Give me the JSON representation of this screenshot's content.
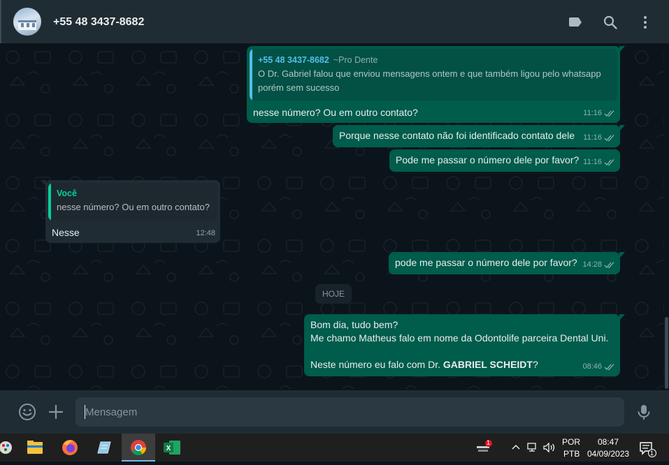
{
  "header": {
    "contact_name": "+55 48 3437-8682",
    "icons": [
      "label-icon",
      "search-icon",
      "menu-icon"
    ]
  },
  "messages": [
    {
      "direction": "out",
      "quote": {
        "author": "+55 48 3437-8682",
        "author_tag": "~Pro Dente",
        "text_line1": "O Dr. Gabriel falou que enviou mensagens ontem e que também ligou pelo whatsapp",
        "text_line2": "porém sem sucesso"
      },
      "text": "nesse número? Ou em outro contato?",
      "time": "11:16"
    },
    {
      "direction": "out",
      "text": "Porque nesse contato não foi identificado contato dele",
      "time": "11:16"
    },
    {
      "direction": "out",
      "text": "Pode me passar o número dele por favor?",
      "time": "11:16"
    },
    {
      "direction": "in",
      "quote": {
        "author": "Você",
        "text": "nesse número? Ou em outro contato?"
      },
      "text": "Nesse",
      "time": "12:48"
    },
    {
      "direction": "out",
      "text": "pode me passar o número dele por favor?",
      "time": "14:28"
    },
    {
      "direction": "out",
      "line1": "Bom dia, tudo bem?",
      "line2": "Me chamo Matheus falo em nome da Odontolife parceira Dental Uni.",
      "line3_prefix": "Neste número eu falo com Dr. ",
      "line3_bold": "GABRIEL SCHEIDT",
      "line3_suffix": "?",
      "time": "08:46"
    }
  ],
  "date_separator": "HOJE",
  "composer": {
    "placeholder": "Mensagem",
    "value": ""
  },
  "taskbar": {
    "apps": [
      "paint-app-icon",
      "file-explorer-icon",
      "firefox-icon",
      "notepad-icon",
      "chrome-icon",
      "excel-icon"
    ],
    "active_app": "chrome-icon",
    "notification_badge": "1",
    "language_line1": "POR",
    "language_line2": "PTB",
    "time": "08:47",
    "date": "04/09/2023",
    "action_center_count": "1"
  },
  "colors": {
    "outgoing_bubble": "#005c4b",
    "incoming_bubble": "#202c33",
    "chat_background": "#0b141a",
    "quote_author_out": "#53bdeb",
    "quote_author_in": "#06cf9c"
  }
}
